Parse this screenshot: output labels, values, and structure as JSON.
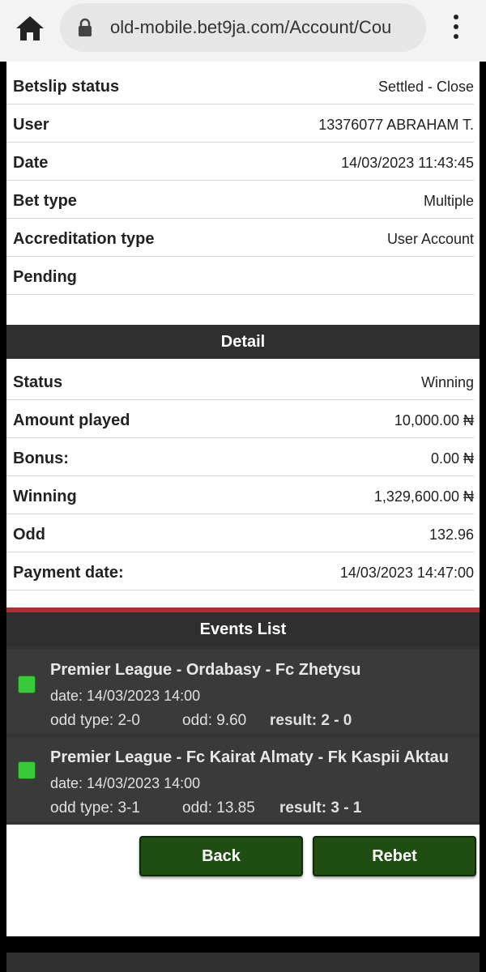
{
  "browser": {
    "url": "old-mobile.bet9ja.com/Account/Cou"
  },
  "summary": [
    {
      "label": "Betslip status",
      "value": "Settled - Close"
    },
    {
      "label": "User",
      "value": "13376077 ABRAHAM T."
    },
    {
      "label": "Date",
      "value": "14/03/2023 11:43:45"
    },
    {
      "label": "Bet type",
      "value": "Multiple"
    },
    {
      "label": "Accreditation type",
      "value": "User Account"
    },
    {
      "label": "Pending",
      "value": ""
    }
  ],
  "detail": {
    "title": "Detail",
    "rows": [
      {
        "label": "Status",
        "value": "Winning"
      },
      {
        "label": "Amount played",
        "value": "10,000.00 ₦"
      },
      {
        "label": "Bonus:",
        "value": "0.00 ₦"
      },
      {
        "label": "Winning",
        "value": "1,329,600.00 ₦"
      },
      {
        "label": "Odd",
        "value": "132.96"
      },
      {
        "label": "Payment date:",
        "value": "14/03/2023 14:47:00"
      }
    ]
  },
  "events": {
    "title": "Events List",
    "items": [
      {
        "title": "Premier League - Ordabasy - Fc Zhetysu",
        "date": "date: 14/03/2023 14:00",
        "odd_type": "odd type: 2-0",
        "odd": "odd: 9.60",
        "result": "result: 2 - 0"
      },
      {
        "title": "Premier League - Fc Kairat Almaty - Fk Kaspii Aktau",
        "date": "date: 14/03/2023 14:00",
        "odd_type": "odd type: 3-1",
        "odd": "odd: 13.85",
        "result": "result: 3 - 1"
      }
    ]
  },
  "buttons": {
    "back": "Back",
    "rebet": "Rebet"
  },
  "colors": {
    "header_bg": "#2f2f2f",
    "accent_red": "#a83232",
    "button_green": "#1f4d12",
    "status_green": "#39c93a"
  }
}
